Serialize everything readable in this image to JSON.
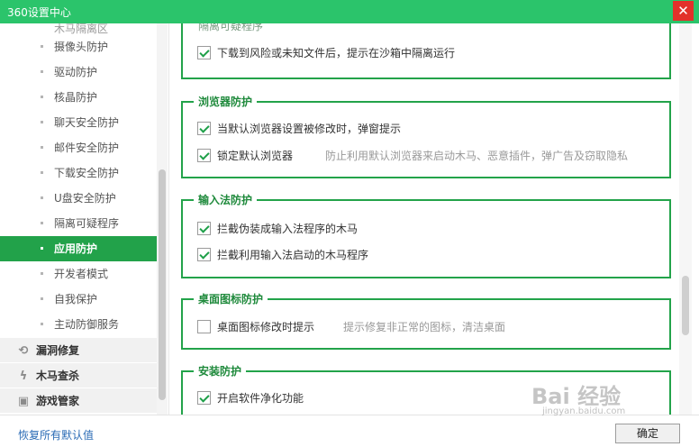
{
  "window": {
    "title": "360设置中心",
    "close_glyph": "✕"
  },
  "sidebar": {
    "partial_item": "木马隔离区",
    "items": [
      {
        "label": "摄像头防护",
        "active": false
      },
      {
        "label": "驱动防护",
        "active": false
      },
      {
        "label": "核晶防护",
        "active": false
      },
      {
        "label": "聊天安全防护",
        "active": false
      },
      {
        "label": "邮件安全防护",
        "active": false
      },
      {
        "label": "下载安全防护",
        "active": false
      },
      {
        "label": "U盘安全防护",
        "active": false
      },
      {
        "label": "隔离可疑程序",
        "active": false
      },
      {
        "label": "应用防护",
        "active": true
      },
      {
        "label": "开发者模式",
        "active": false
      },
      {
        "label": "自我保护",
        "active": false
      },
      {
        "label": "主动防御服务",
        "active": false
      }
    ],
    "groups": [
      {
        "label": "漏洞修复",
        "icon": "shield-refresh-icon"
      },
      {
        "label": "木马查杀",
        "icon": "lightning-icon"
      },
      {
        "label": "游戏管家",
        "icon": "gamepad-icon"
      }
    ]
  },
  "sections": {
    "quarantine": {
      "title": "隔离可疑程序",
      "options": [
        {
          "label": "下载到风险或未知文件后，提示在沙箱中隔离运行",
          "checked": true
        }
      ]
    },
    "browser": {
      "title": "浏览器防护",
      "options": [
        {
          "label": "当默认浏览器设置被修改时，弹窗提示",
          "checked": true
        },
        {
          "label": "锁定默认浏览器",
          "checked": true,
          "hint": "防止利用默认浏览器来启动木马、恶意插件，弹广告及窃取隐私"
        }
      ]
    },
    "ime": {
      "title": "输入法防护",
      "options": [
        {
          "label": "拦截伪装成输入法程序的木马",
          "checked": true
        },
        {
          "label": "拦截利用输入法启动的木马程序",
          "checked": true
        }
      ]
    },
    "desktop": {
      "title": "桌面图标防护",
      "options": [
        {
          "label": "桌面图标修改时提示",
          "checked": false,
          "hint": "提示修复非正常的图标，清洁桌面"
        }
      ]
    },
    "install": {
      "title": "安装防护",
      "options": [
        {
          "label": "开启软件净化功能",
          "checked": true
        }
      ]
    }
  },
  "footer": {
    "restore_label": "恢复所有默认值",
    "ok_label": "确定"
  },
  "watermark": {
    "main": "Bai 经验",
    "sub": "jingyan.baidu.com"
  },
  "colors": {
    "titlebar": "#2bc46b",
    "accent": "#22a24a",
    "close": "#e2312a",
    "link": "#2a6bb5"
  }
}
